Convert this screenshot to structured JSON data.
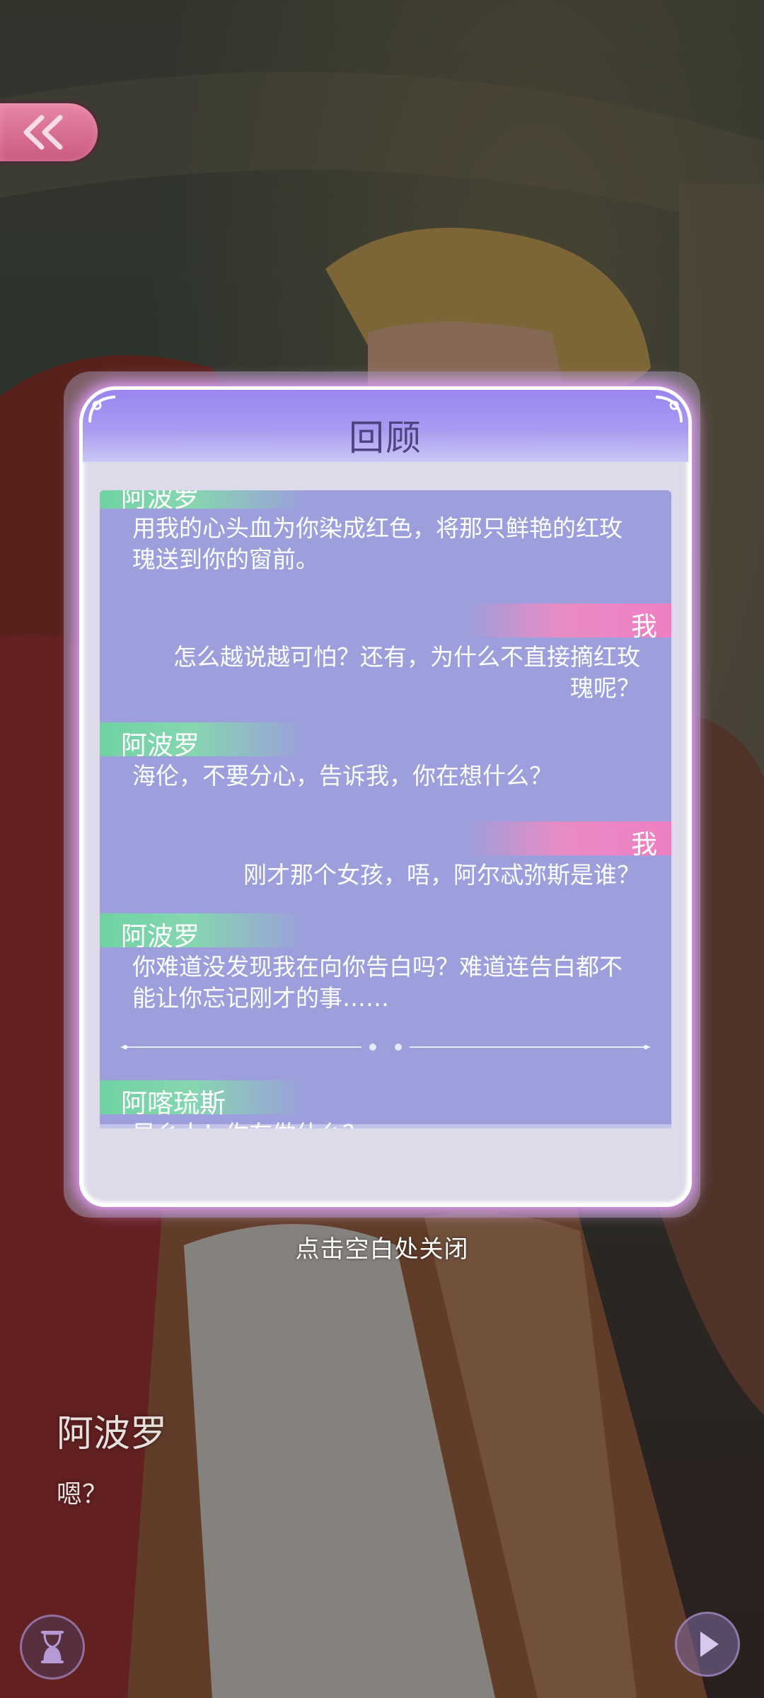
{
  "back_button": {
    "icon": "double-chevron-left-icon"
  },
  "history": {
    "title": "回顾",
    "entries": [
      {
        "speaker": "阿波罗",
        "side": "left",
        "text": "用我的心头血为你染成红色，将那只鲜艳的红玫瑰送到你的窗前。"
      },
      {
        "speaker": "我",
        "side": "right",
        "text": "怎么越说越可怕？还有，为什么不直接摘红玫瑰呢？"
      },
      {
        "speaker": "阿波罗",
        "side": "left",
        "text": "海伦，不要分心，告诉我，你在想什么？"
      },
      {
        "speaker": "我",
        "side": "right",
        "text": "刚才那个女孩，唔，阿尔忒弥斯是谁？"
      },
      {
        "speaker": "阿波罗",
        "side": "left",
        "text": "你难道没发现我在向你告白吗？难道连告白都不能让你忘记刚才的事……"
      },
      {
        "speaker": "阿喀琉斯",
        "side": "left",
        "text": "异乡人！你在做什么？"
      }
    ]
  },
  "close_hint": "点击空白处关闭",
  "dialogue": {
    "speaker": "阿波罗",
    "line": "嗯？"
  },
  "buttons": {
    "auto": "hourglass-icon",
    "next": "play-icon"
  },
  "colors": {
    "panel_purple": "#9c9fdc",
    "name_green": "#6fd3a2",
    "name_pink": "#ef7fc2",
    "title": "#4d4380"
  }
}
